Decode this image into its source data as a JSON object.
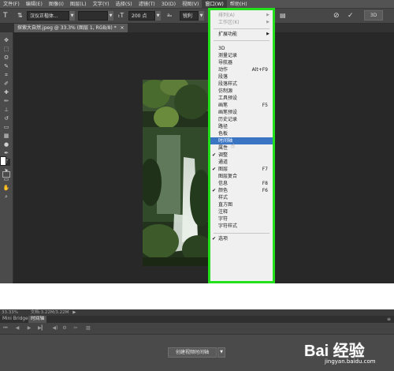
{
  "menubar": {
    "items": [
      "文件(F)",
      "编辑(E)",
      "图像(I)",
      "图层(L)",
      "文字(Y)",
      "选择(S)",
      "滤镜(T)",
      "3D(D)",
      "视图(V)",
      "窗口(W)",
      "帮助(H)"
    ]
  },
  "options": {
    "font_family": "汉仪正楷体...",
    "font_size": "200 点",
    "antialias": "锐利"
  },
  "document": {
    "tab_title": "探索大自然.jpeg @ 33.3% (图层 1, RGB/8) *"
  },
  "window_menu": {
    "items": [
      {
        "label": "排列(A)",
        "shortcut": "",
        "submenu": true,
        "disabled": true,
        "checked": false,
        "highlighted": false
      },
      {
        "label": "工作区(K)",
        "shortcut": "",
        "submenu": true,
        "disabled": true,
        "checked": false,
        "highlighted": false
      },
      {
        "label": "扩展功能",
        "shortcut": "",
        "submenu": true,
        "disabled": false,
        "checked": false,
        "highlighted": false
      },
      {
        "label": "3D",
        "shortcut": "",
        "submenu": false,
        "disabled": false,
        "checked": false,
        "highlighted": false
      },
      {
        "label": "测量记录",
        "shortcut": "",
        "submenu": false,
        "disabled": false,
        "checked": false,
        "highlighted": false
      },
      {
        "label": "导航器",
        "shortcut": "",
        "submenu": false,
        "disabled": false,
        "checked": false,
        "highlighted": false
      },
      {
        "label": "动作",
        "shortcut": "Alt+F9",
        "submenu": false,
        "disabled": false,
        "checked": false,
        "highlighted": false
      },
      {
        "label": "段落",
        "shortcut": "",
        "submenu": false,
        "disabled": false,
        "checked": false,
        "highlighted": false
      },
      {
        "label": "段落样式",
        "shortcut": "",
        "submenu": false,
        "disabled": false,
        "checked": false,
        "highlighted": false
      },
      {
        "label": "仿制源",
        "shortcut": "",
        "submenu": false,
        "disabled": false,
        "checked": false,
        "highlighted": false
      },
      {
        "label": "工具预设",
        "shortcut": "",
        "submenu": false,
        "disabled": false,
        "checked": false,
        "highlighted": false
      },
      {
        "label": "画笔",
        "shortcut": "F5",
        "submenu": false,
        "disabled": false,
        "checked": false,
        "highlighted": false
      },
      {
        "label": "画笔预设",
        "shortcut": "",
        "submenu": false,
        "disabled": false,
        "checked": false,
        "highlighted": false
      },
      {
        "label": "历史记录",
        "shortcut": "",
        "submenu": false,
        "disabled": false,
        "checked": false,
        "highlighted": false
      },
      {
        "label": "路径",
        "shortcut": "",
        "submenu": false,
        "disabled": false,
        "checked": false,
        "highlighted": false
      },
      {
        "label": "色板",
        "shortcut": "",
        "submenu": false,
        "disabled": false,
        "checked": false,
        "highlighted": false
      },
      {
        "label": "时间轴",
        "shortcut": "",
        "submenu": false,
        "disabled": false,
        "checked": false,
        "highlighted": true
      },
      {
        "label": "属性",
        "shortcut": "",
        "submenu": false,
        "disabled": false,
        "checked": false,
        "highlighted": false
      },
      {
        "label": "调整",
        "shortcut": "",
        "submenu": false,
        "disabled": false,
        "checked": true,
        "highlighted": false
      },
      {
        "label": "通道",
        "shortcut": "",
        "submenu": false,
        "disabled": false,
        "checked": false,
        "highlighted": false
      },
      {
        "label": "图层",
        "shortcut": "F7",
        "submenu": false,
        "disabled": false,
        "checked": true,
        "highlighted": false
      },
      {
        "label": "图层复合",
        "shortcut": "",
        "submenu": false,
        "disabled": false,
        "checked": false,
        "highlighted": false
      },
      {
        "label": "信息",
        "shortcut": "F8",
        "submenu": false,
        "disabled": false,
        "checked": false,
        "highlighted": false
      },
      {
        "label": "颜色",
        "shortcut": "F6",
        "submenu": false,
        "disabled": false,
        "checked": true,
        "highlighted": false
      },
      {
        "label": "样式",
        "shortcut": "",
        "submenu": false,
        "disabled": false,
        "checked": false,
        "highlighted": false
      },
      {
        "label": "直方图",
        "shortcut": "",
        "submenu": false,
        "disabled": false,
        "checked": false,
        "highlighted": false
      },
      {
        "label": "注释",
        "shortcut": "",
        "submenu": false,
        "disabled": false,
        "checked": false,
        "highlighted": false
      },
      {
        "label": "字符",
        "shortcut": "",
        "submenu": false,
        "disabled": false,
        "checked": false,
        "highlighted": false
      },
      {
        "label": "字符样式",
        "shortcut": "",
        "submenu": false,
        "disabled": false,
        "checked": false,
        "highlighted": false
      },
      {
        "label": "选项",
        "shortcut": "",
        "submenu": false,
        "disabled": false,
        "checked": true,
        "highlighted": false
      }
    ],
    "highlight_color": "#3a75c4",
    "annotation_border_color": "#22e01c"
  },
  "status_bar": {
    "zoom": "33.33%",
    "doc_info": "文档:3.22M/3.22M"
  },
  "bottom_panel": {
    "tabs": [
      "Mini Bridge",
      "时间轴"
    ],
    "active_tab": "时间轴",
    "create_button": "创建视频时间轴"
  },
  "watermark": {
    "logo": "Bai 经验",
    "url": "jingyan.baidu.com"
  }
}
